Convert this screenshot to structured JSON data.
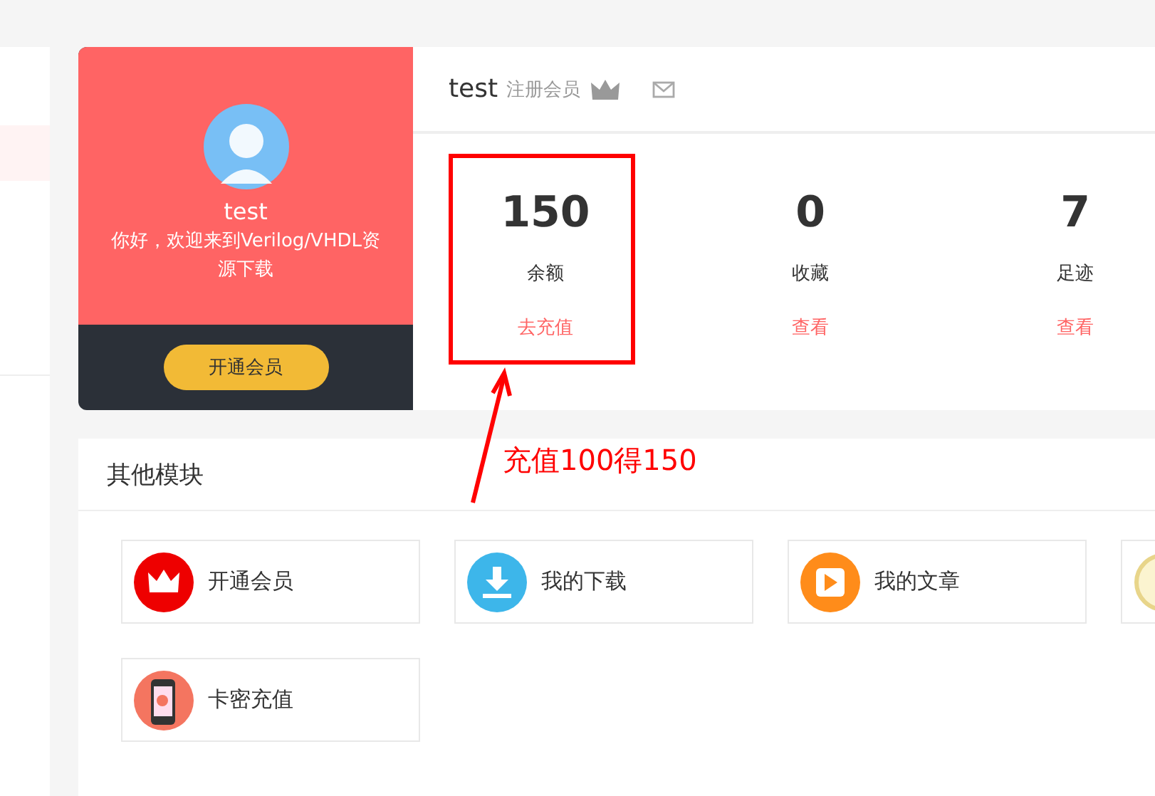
{
  "profile": {
    "name": "test",
    "welcome": "你好，欢迎来到Verilog/VHDL资源下载",
    "button": "开通会员"
  },
  "header": {
    "name": "test",
    "role": "注册会员"
  },
  "stats": [
    {
      "value": "150",
      "label": "余额",
      "link": "去充值"
    },
    {
      "value": "0",
      "label": "收藏",
      "link": "查看"
    },
    {
      "value": "7",
      "label": "足迹",
      "link": "查看"
    }
  ],
  "annotation": {
    "text": "充值100得150"
  },
  "modules": {
    "title": "其他模块",
    "items": [
      {
        "kind": "vip",
        "label": "开通会员"
      },
      {
        "kind": "download",
        "label": "我的下载"
      },
      {
        "kind": "article",
        "label": "我的文章"
      },
      {
        "kind": "medal"
      },
      {
        "kind": "card",
        "label": "卡密充值"
      }
    ]
  }
}
